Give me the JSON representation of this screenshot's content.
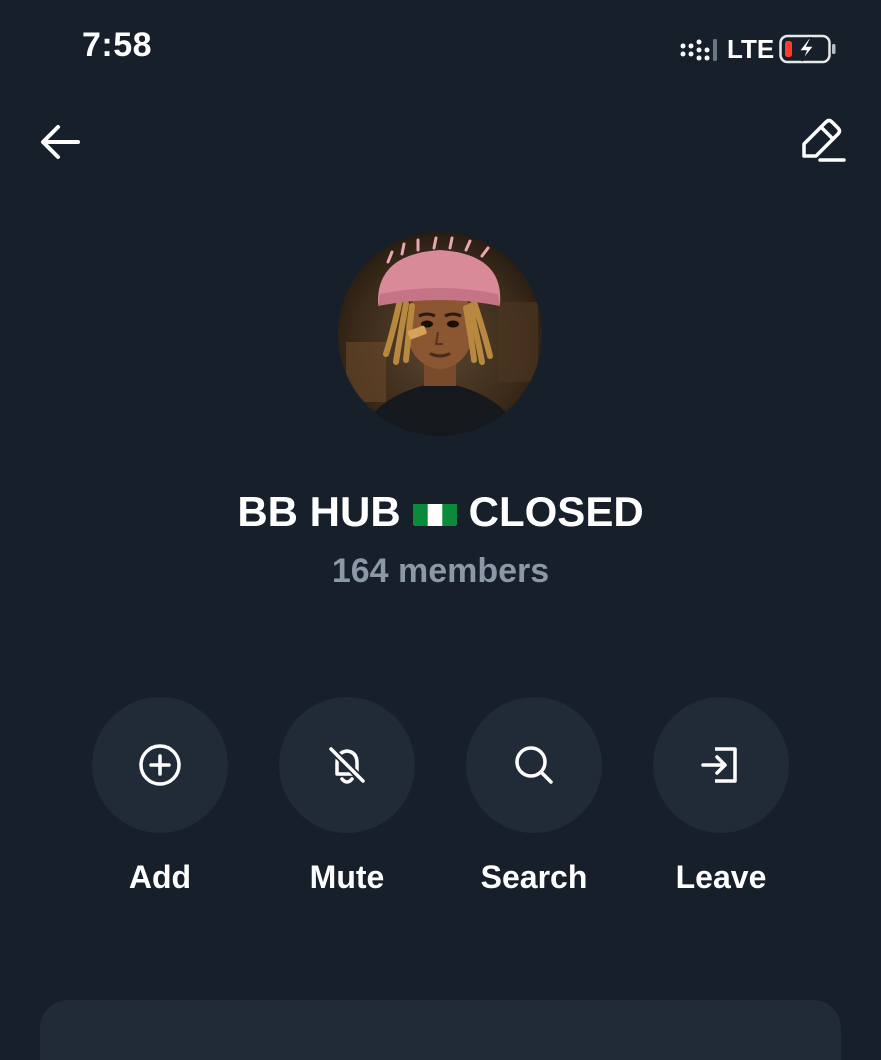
{
  "status_bar": {
    "time": "7:58",
    "network": "LTE",
    "icons": {
      "signal": "signal-bars-icon",
      "battery": "battery-charging-low-icon"
    }
  },
  "header": {
    "back_icon": "arrow-left-icon",
    "edit_icon": "pencil-edit-icon"
  },
  "group": {
    "title_left": "BB HUB",
    "flag": "nigeria-flag",
    "title_right": "CLOSED",
    "members": "164 members"
  },
  "actions": [
    {
      "label": "Add",
      "icon": "plus-circle-icon"
    },
    {
      "label": "Mute",
      "icon": "bell-off-icon"
    },
    {
      "label": "Search",
      "icon": "search-icon"
    },
    {
      "label": "Leave",
      "icon": "leave-icon"
    }
  ],
  "colors": {
    "background": "#161f2a",
    "action_circle": "#202b37",
    "muted_text": "#8b98a5",
    "battery_low": "#ff3b30",
    "flag_green": "#0a8a3a"
  }
}
